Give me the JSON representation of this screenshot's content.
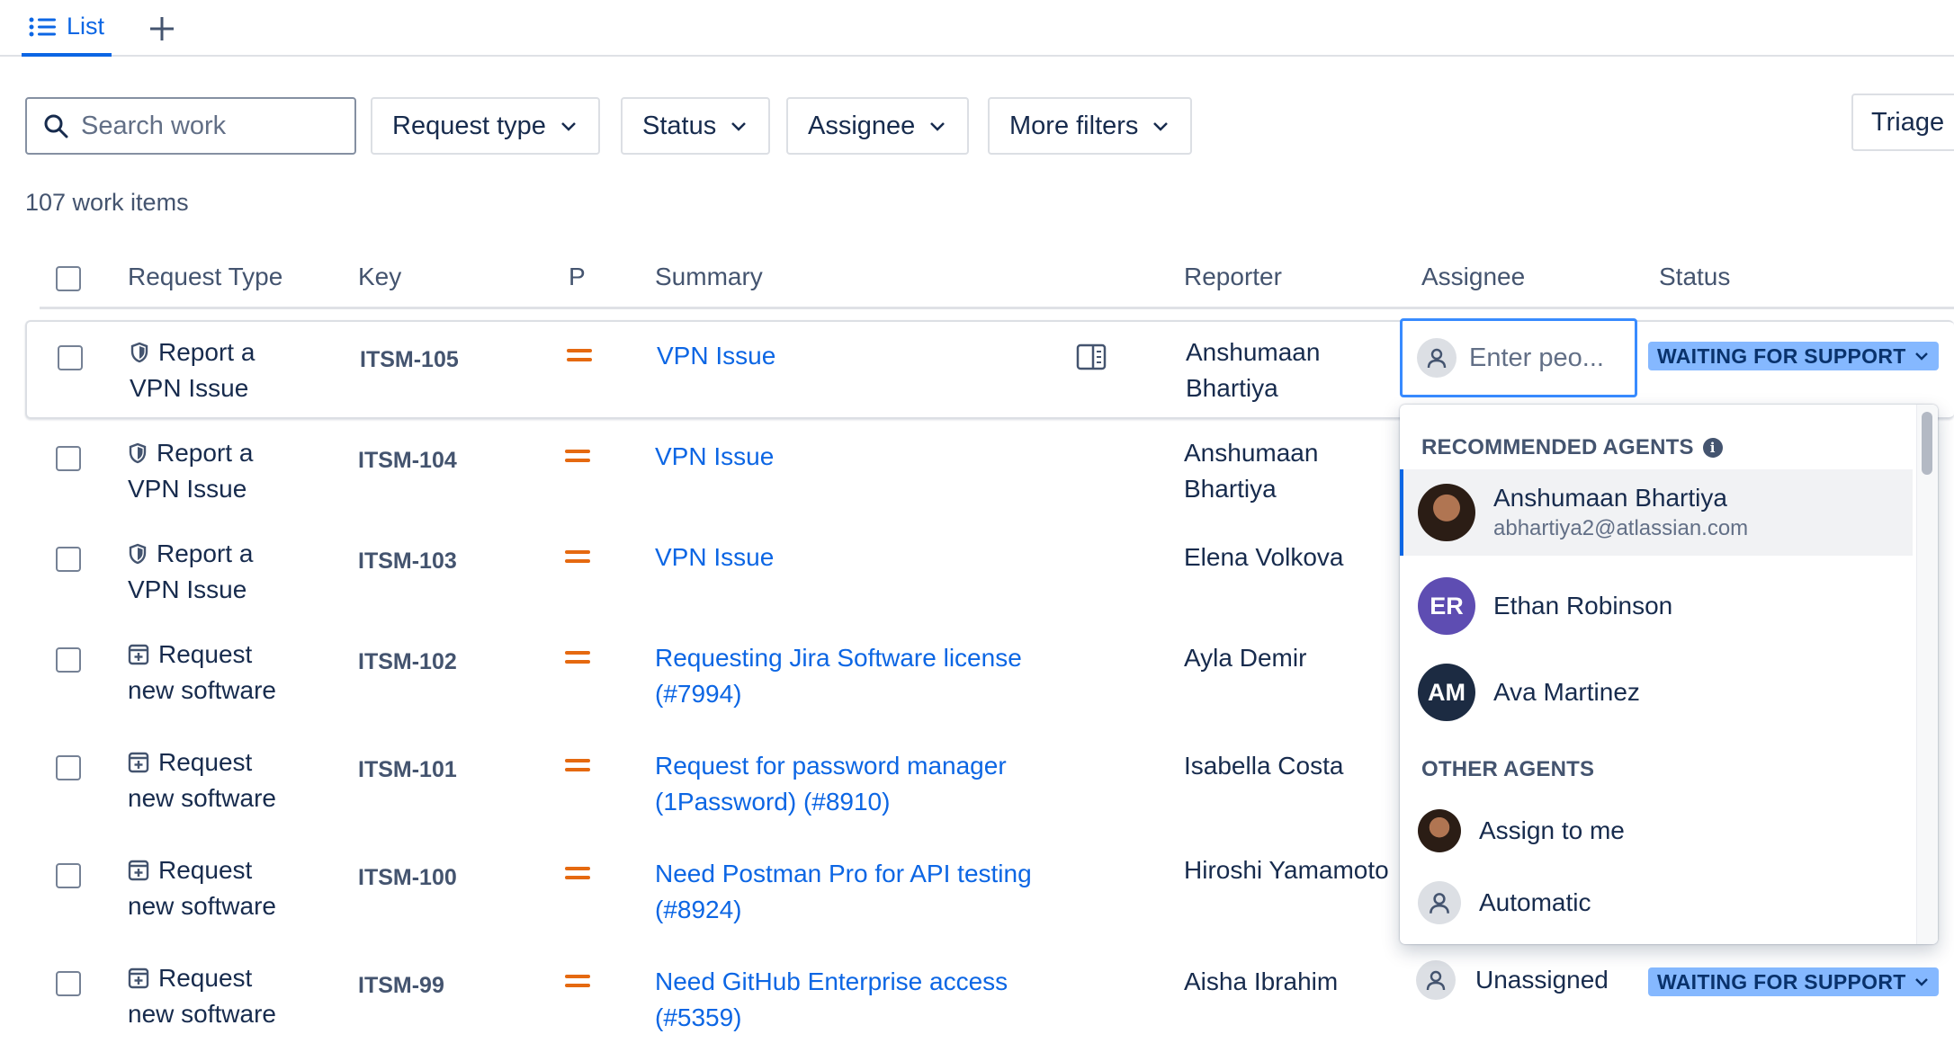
{
  "tabs": {
    "list_label": "List",
    "add_label": "+"
  },
  "filters": {
    "search_placeholder": "Search work",
    "request_type": "Request type",
    "status": "Status",
    "assignee": "Assignee",
    "more": "More filters",
    "triage": "Triage"
  },
  "count_label": "107 work items",
  "columns": {
    "request_type": "Request Type",
    "key": "Key",
    "priority": "P",
    "summary": "Summary",
    "reporter": "Reporter",
    "assignee": "Assignee",
    "status": "Status"
  },
  "rows": [
    {
      "type_line1": "Report a",
      "type_line2": "VPN Issue",
      "type_icon": "shield-icon",
      "key": "ITSM-105",
      "summary": "VPN Issue",
      "reporter": "Anshumaan Bhartiya",
      "status": "WAITING FOR SUPPORT"
    },
    {
      "type_line1": "Report a",
      "type_line2": "VPN Issue",
      "type_icon": "shield-icon",
      "key": "ITSM-104",
      "summary": "VPN Issue",
      "reporter": "Anshumaan Bhartiya"
    },
    {
      "type_line1": "Report a",
      "type_line2": "VPN Issue",
      "type_icon": "shield-icon",
      "key": "ITSM-103",
      "summary": "VPN Issue",
      "reporter": "Elena Volkova"
    },
    {
      "type_line1": "Request",
      "type_line2": "new software",
      "type_icon": "software-plus-icon",
      "key": "ITSM-102",
      "summary": "Requesting Jira Software license (#7994)",
      "reporter": "Ayla Demir"
    },
    {
      "type_line1": "Request",
      "type_line2": "new software",
      "type_icon": "software-plus-icon",
      "key": "ITSM-101",
      "summary": "Request for password manager (1Password) (#8910)",
      "reporter": "Isabella Costa"
    },
    {
      "type_line1": "Request",
      "type_line2": "new software",
      "type_icon": "software-plus-icon",
      "key": "ITSM-100",
      "summary": "Need Postman Pro for API testing (#8924)",
      "reporter": "Hiroshi Yamamoto"
    },
    {
      "type_line1": "Request",
      "type_line2": "new software",
      "type_icon": "software-plus-icon",
      "key": "ITSM-99",
      "summary": "Need GitHub Enterprise access (#5359)",
      "reporter": "Aisha Ibrahim",
      "assignee": "Unassigned",
      "status": "WAITING FOR SUPPORT"
    }
  ],
  "assignee_input": {
    "placeholder": "Enter peo..."
  },
  "dropdown": {
    "recommended_heading": "RECOMMENDED AGENTS",
    "other_heading": "OTHER AGENTS",
    "recommended": [
      {
        "name": "Anshumaan Bhartiya",
        "email": "abhartiya2@atlassian.com",
        "initials": ""
      },
      {
        "name": "Ethan Robinson",
        "initials": "ER",
        "color": "#5e4db2"
      },
      {
        "name": "Ava Martinez",
        "initials": "AM",
        "color": "#1c2b42"
      }
    ],
    "other": [
      {
        "name": "Assign to me"
      },
      {
        "name": "Automatic"
      }
    ]
  },
  "colors": {
    "accent": "#0c66e4",
    "priority": "#e56910",
    "lozenge": "#85b8ff"
  }
}
